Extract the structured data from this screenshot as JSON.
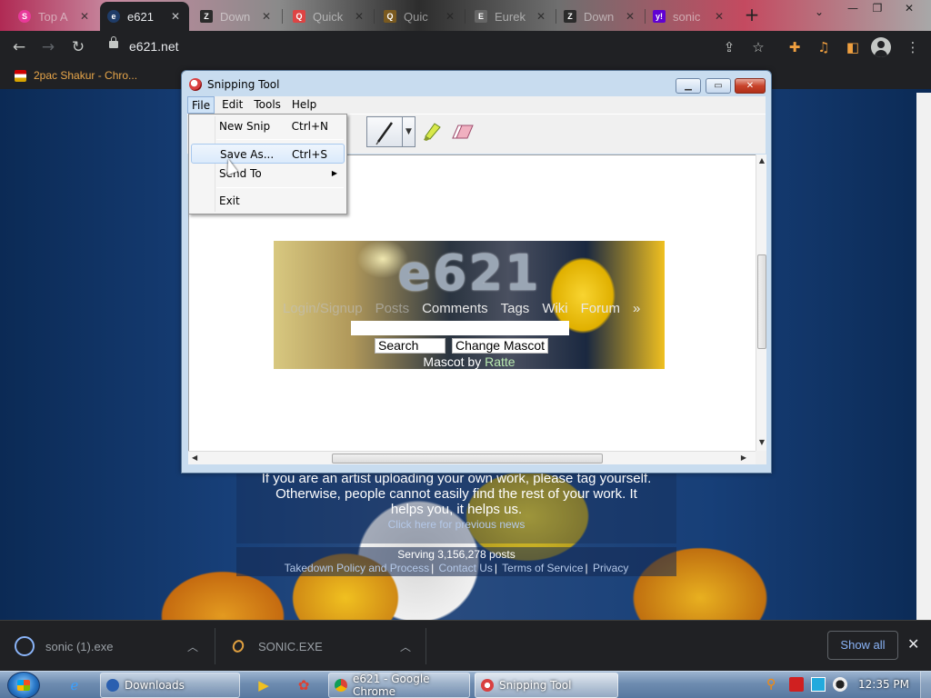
{
  "browser": {
    "tabs": [
      {
        "title": "Top A",
        "favicon_color": "#e8399a",
        "favicon_letter": "S"
      },
      {
        "title": "e621",
        "favicon_color": "#1f3c68",
        "favicon_letter": "e",
        "active": true
      },
      {
        "title": "Down",
        "favicon_color": "#2b2b2b",
        "favicon_letter": "Z"
      },
      {
        "title": "Quick",
        "favicon_color": "#d44",
        "favicon_letter": "Q"
      },
      {
        "title": "Quic",
        "favicon_color": "#7a5a20",
        "favicon_letter": "Q"
      },
      {
        "title": "Eurek",
        "favicon_color": "#666",
        "favicon_letter": "E"
      },
      {
        "title": "Down",
        "favicon_color": "#2b2b2b",
        "favicon_letter": "Z"
      },
      {
        "title": "sonic",
        "favicon_color": "#6001d2",
        "favicon_letter": "y!"
      }
    ],
    "new_tab_symbol": "+",
    "url": "e621.net",
    "bookmark": "2pac Shakur - Chro..."
  },
  "snipping_tool": {
    "title": "Snipping Tool",
    "menus": [
      "File",
      "Edit",
      "Tools",
      "Help"
    ],
    "open_menu": "File",
    "file_menu": [
      {
        "label": "New Snip",
        "shortcut": "Ctrl+N"
      },
      {
        "label": "Save As...",
        "shortcut": "Ctrl+S",
        "hovered": true
      },
      {
        "label": "Send To",
        "shortcut": "",
        "submenu": true
      },
      {
        "label": "Exit",
        "shortcut": ""
      }
    ],
    "captured": {
      "site_title": "e621",
      "nav": [
        "Login/Signup",
        "Posts",
        "Comments",
        "Tags",
        "Wiki",
        "Forum",
        "»"
      ],
      "search_button": "Search",
      "mascot_button": "Change Mascot",
      "mascot_text": "Mascot by",
      "mascot_artist": "Ratte"
    }
  },
  "page": {
    "news_lines": [
      "If you are an artist uploading your own work, please tag yourself.",
      "Otherwise, people cannot easily find the rest of your work. It",
      "helps you, it helps us."
    ],
    "previous_news": "Click here for previous news",
    "serving": "Serving 3,156,278 posts",
    "footer_links": [
      "Takedown Policy and Process",
      "Contact Us",
      "Terms of Service",
      "Privacy"
    ]
  },
  "downloads": {
    "items": [
      {
        "name": "sonic (1).exe"
      },
      {
        "name": "SONIC.EXE"
      }
    ],
    "show_all": "Show all"
  },
  "taskbar": {
    "buttons": [
      {
        "label": "Downloads"
      },
      {
        "label": "e621 - Google Chrome"
      },
      {
        "label": "Snipping Tool",
        "active": true
      }
    ],
    "clock": "12:35 PM"
  }
}
